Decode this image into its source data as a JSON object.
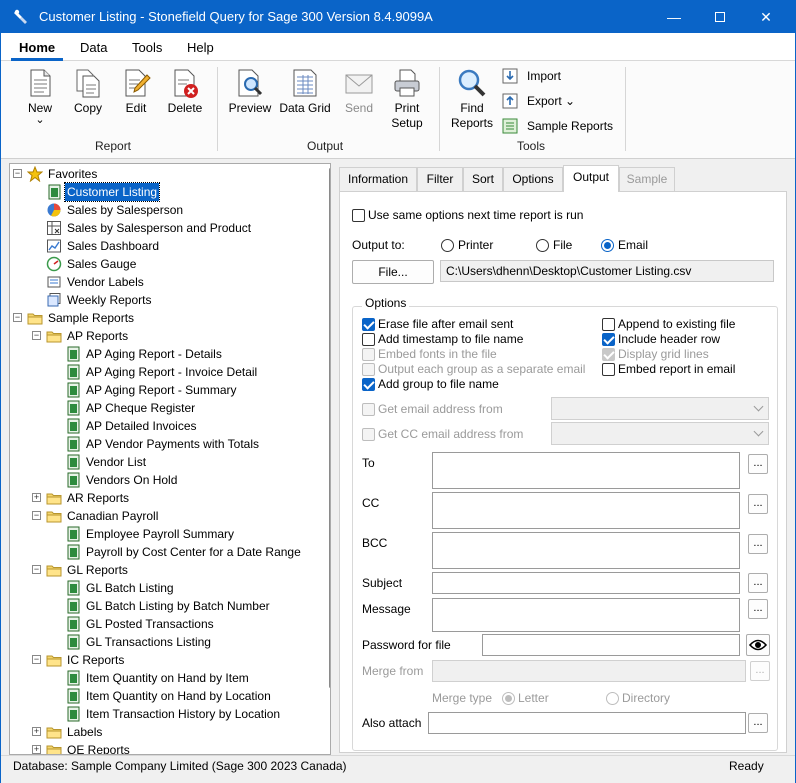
{
  "window": {
    "title": "Customer Listing - Stonefield Query for Sage 300 Version 8.4.9099A"
  },
  "ribbon_tabs": [
    "Home",
    "Data",
    "Tools",
    "Help"
  ],
  "ribbon": {
    "report": {
      "group": "Report",
      "new": "New",
      "new_arrow": "⌄",
      "copy": "Copy",
      "edit": "Edit",
      "delete": "Delete"
    },
    "output": {
      "group": "Output",
      "preview": "Preview",
      "data_grid": "Data Grid",
      "send": "Send",
      "print_setup_1": "Print",
      "print_setup_2": "Setup"
    },
    "tools": {
      "group": "Tools",
      "find_1": "Find",
      "find_2": "Reports",
      "import": "Import",
      "export": "Export ⌄",
      "sample_reports": "Sample Reports"
    }
  },
  "tree": [
    {
      "level": 0,
      "label": "Favorites",
      "icon": "star",
      "exp": "−"
    },
    {
      "level": 1,
      "label": "Customer Listing",
      "icon": "report",
      "selected": true
    },
    {
      "level": 1,
      "label": "Sales by Salesperson",
      "icon": "pie"
    },
    {
      "level": 1,
      "label": "Sales by Salesperson and Product",
      "icon": "crosstab"
    },
    {
      "level": 1,
      "label": "Sales Dashboard",
      "icon": "dashboard"
    },
    {
      "level": 1,
      "label": "Sales Gauge",
      "icon": "gauge"
    },
    {
      "level": 1,
      "label": "Vendor Labels",
      "icon": "label"
    },
    {
      "level": 1,
      "label": "Weekly Reports",
      "icon": "batch"
    },
    {
      "level": 0,
      "label": "Sample Reports",
      "icon": "folder",
      "exp": "−"
    },
    {
      "level": 1,
      "label": "AP Reports",
      "icon": "folder",
      "exp": "−"
    },
    {
      "level": 2,
      "label": "AP Aging Report - Details",
      "icon": "report"
    },
    {
      "level": 2,
      "label": "AP Aging Report - Invoice Detail",
      "icon": "report"
    },
    {
      "level": 2,
      "label": "AP Aging Report - Summary",
      "icon": "report"
    },
    {
      "level": 2,
      "label": "AP Cheque Register",
      "icon": "report"
    },
    {
      "level": 2,
      "label": "AP Detailed Invoices",
      "icon": "report"
    },
    {
      "level": 2,
      "label": "AP Vendor Payments with Totals",
      "icon": "report"
    },
    {
      "level": 2,
      "label": "Vendor List",
      "icon": "report"
    },
    {
      "level": 2,
      "label": "Vendors On Hold",
      "icon": "report"
    },
    {
      "level": 1,
      "label": "AR Reports",
      "icon": "folder",
      "exp": "+"
    },
    {
      "level": 1,
      "label": "Canadian Payroll",
      "icon": "folder",
      "exp": "−"
    },
    {
      "level": 2,
      "label": "Employee Payroll Summary",
      "icon": "report"
    },
    {
      "level": 2,
      "label": "Payroll by Cost Center for a Date Range",
      "icon": "report"
    },
    {
      "level": 1,
      "label": "GL Reports",
      "icon": "folder",
      "exp": "−"
    },
    {
      "level": 2,
      "label": "GL Batch Listing",
      "icon": "report"
    },
    {
      "level": 2,
      "label": "GL Batch Listing by Batch Number",
      "icon": "report"
    },
    {
      "level": 2,
      "label": "GL Posted Transactions",
      "icon": "report"
    },
    {
      "level": 2,
      "label": "GL Transactions Listing",
      "icon": "report"
    },
    {
      "level": 1,
      "label": "IC Reports",
      "icon": "folder",
      "exp": "−"
    },
    {
      "level": 2,
      "label": "Item Quantity on Hand by Item",
      "icon": "report"
    },
    {
      "level": 2,
      "label": "Item Quantity on Hand by Location",
      "icon": "report"
    },
    {
      "level": 2,
      "label": "Item Transaction History by Location",
      "icon": "report"
    },
    {
      "level": 1,
      "label": "Labels",
      "icon": "folder",
      "exp": "+"
    },
    {
      "level": 1,
      "label": "OE Reports",
      "icon": "folder",
      "exp": "+"
    }
  ],
  "tabs": [
    "Information",
    "Filter",
    "Sort",
    "Options",
    "Output",
    "Sample"
  ],
  "output": {
    "same_options": "Use same options next time report is run",
    "output_to": "Output to:",
    "printer": "Printer",
    "file": "File",
    "email": "Email",
    "file_button": "File...",
    "file_path": "C:\\Users\\dhenn\\Desktop\\Customer Listing.csv",
    "options_title": "Options",
    "erase_file": "Erase file after email sent",
    "add_timestamp": "Add timestamp to file name",
    "embed_fonts": "Embed fonts in the file",
    "output_each_group": "Output each group as a separate email",
    "add_group": "Add group to file name",
    "append_existing": "Append to existing file",
    "include_header": "Include header row",
    "display_grid": "Display grid lines",
    "embed_report": "Embed report in email",
    "get_email_from": "Get email address from",
    "get_cc_from": "Get CC email address from",
    "to": "To",
    "cc": "CC",
    "bcc": "BCC",
    "subject": "Subject",
    "message": "Message",
    "password": "Password for file",
    "merge_from": "Merge from",
    "merge_type": "Merge type",
    "letter": "Letter",
    "directory": "Directory",
    "also_attach": "Also attach",
    "ellipsis": "..."
  },
  "status": {
    "database": "Database: Sample Company Limited (Sage 300 2023 Canada)",
    "ready": "Ready"
  }
}
